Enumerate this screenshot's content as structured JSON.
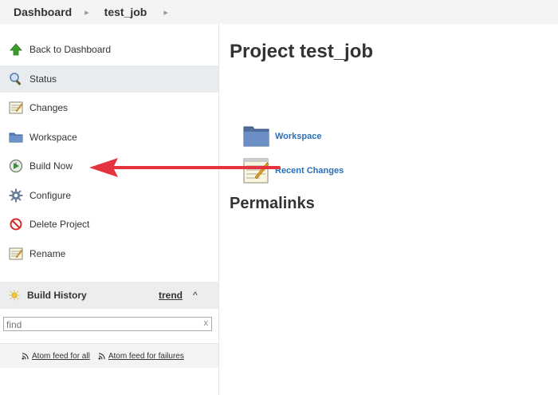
{
  "breadcrumbs": {
    "items": [
      "Dashboard",
      "test_job"
    ]
  },
  "sidebar": {
    "tasks": [
      {
        "label": "Back to Dashboard",
        "icon": "up-arrow-icon"
      },
      {
        "label": "Status",
        "icon": "magnifier-icon"
      },
      {
        "label": "Changes",
        "icon": "notepad-icon"
      },
      {
        "label": "Workspace",
        "icon": "folder-icon"
      },
      {
        "label": "Build Now",
        "icon": "build-clock-icon"
      },
      {
        "label": "Configure",
        "icon": "gear-icon"
      },
      {
        "label": "Delete Project",
        "icon": "no-entry-icon"
      },
      {
        "label": "Rename",
        "icon": "notepad-icon"
      }
    ]
  },
  "build_history": {
    "title": "Build History",
    "trend_label": "trend",
    "search_placeholder": "find",
    "clear_label": "x",
    "feed_all": "Atom feed for all",
    "feed_failures": "Atom feed for failures"
  },
  "main": {
    "title": "Project test_job",
    "links": [
      {
        "label": "Workspace",
        "icon": "folder-icon"
      },
      {
        "label": "Recent Changes",
        "icon": "notepad-icon"
      }
    ],
    "permalinks_heading": "Permalinks"
  },
  "colors": {
    "link": "#2a6ebb",
    "annotation_arrow": "#e5323f",
    "active_task_bg": "#e8ecef"
  }
}
